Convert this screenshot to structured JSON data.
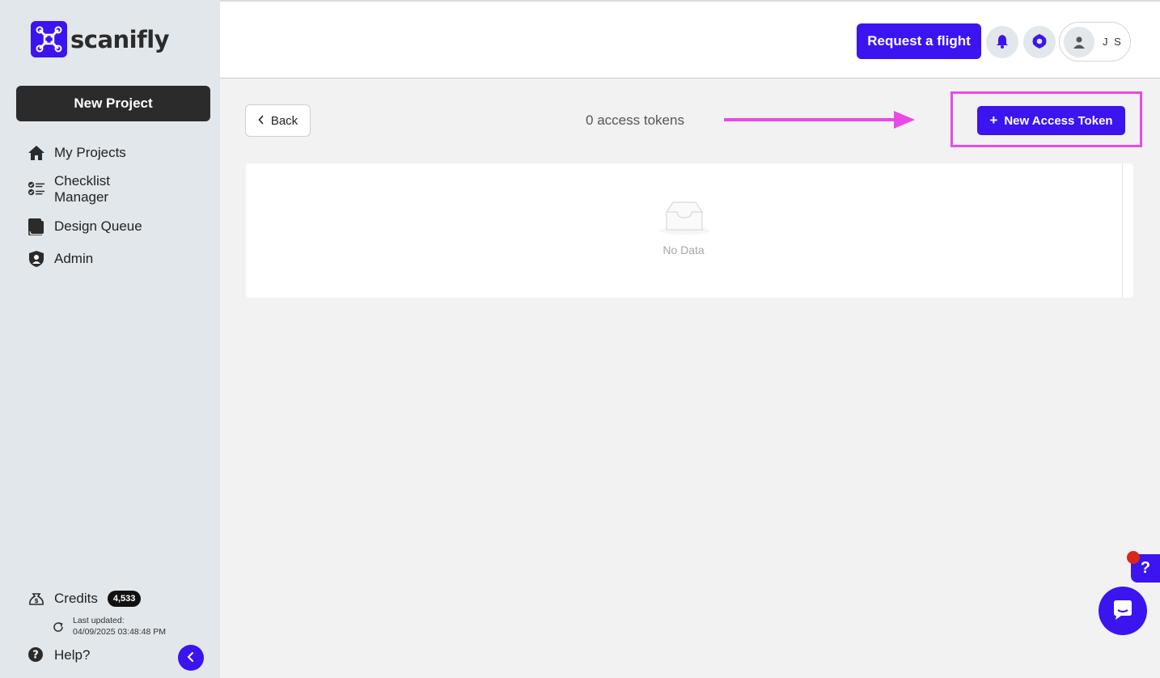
{
  "sidebar": {
    "logo_text": "scanifly",
    "new_project_label": "New Project",
    "items": [
      {
        "label": "My Projects",
        "icon": "home-icon"
      },
      {
        "label": "Checklist\nManager",
        "icon": "checklist-icon"
      },
      {
        "label": "Design Queue",
        "icon": "queue-icon"
      },
      {
        "label": "Admin",
        "icon": "shield-user-icon"
      }
    ],
    "credits_label": "Credits",
    "credits_count": "4,533",
    "last_updated_label": "Last updated:",
    "last_updated_value": "04/09/2025 03:48:48 PM",
    "help_label": "Help?"
  },
  "header": {
    "request_flight_label": "Request a flight",
    "user_initials": "J S"
  },
  "main": {
    "back_label": "Back",
    "token_count": "0 access tokens",
    "new_token_label": "New Access Token",
    "empty_text": "No Data"
  },
  "floating": {
    "help_glyph": "?"
  },
  "colors": {
    "brand": "#3b14f0",
    "highlight": "#e84ae8",
    "sidebar_bg": "#e1e7eb"
  }
}
